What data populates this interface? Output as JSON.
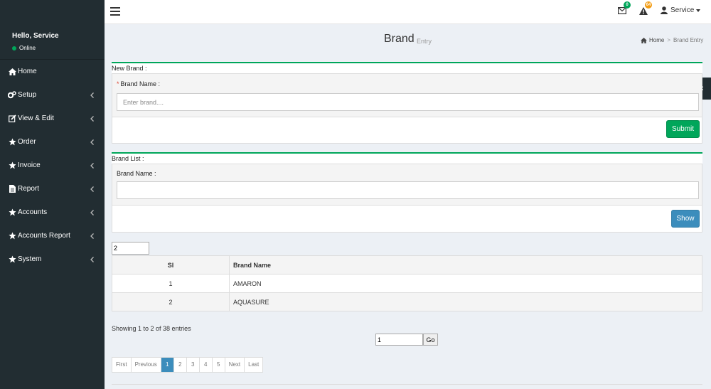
{
  "sidebar": {
    "greeting": "Hello, Service",
    "status": "Online",
    "items": [
      {
        "label": "Home",
        "icon": "home-icon",
        "chevron": false
      },
      {
        "label": "Setup",
        "icon": "cogs-icon",
        "chevron": true
      },
      {
        "label": "View & Edit",
        "icon": "edit-icon",
        "chevron": true
      },
      {
        "label": "Order",
        "icon": "star-icon",
        "chevron": true
      },
      {
        "label": "Invoice",
        "icon": "star-icon",
        "chevron": true
      },
      {
        "label": "Report",
        "icon": "file-icon",
        "chevron": true
      },
      {
        "label": "Accounts",
        "icon": "star-icon",
        "chevron": true
      },
      {
        "label": "Accounts Report",
        "icon": "star-icon",
        "chevron": true
      },
      {
        "label": "System",
        "icon": "star-icon",
        "chevron": true
      }
    ]
  },
  "header": {
    "mail_badge": "0",
    "alert_badge": "64",
    "user_label": "Service",
    "badge_colors": {
      "mail": "#00a65a",
      "alert": "#f39c12"
    }
  },
  "page": {
    "title": "Brand",
    "subtitle": "Entry",
    "breadcrumb": {
      "home": "Home",
      "current": "Brand Entry"
    }
  },
  "new_brand": {
    "title": "New Brand :",
    "label": "Brand Name :",
    "required_mark": "*",
    "placeholder": "Enter brand....",
    "submit_label": "Submit"
  },
  "brand_list": {
    "title": "Brand List :",
    "label": "Brand Name :",
    "value": "",
    "show_label": "Show"
  },
  "table": {
    "page_length": "2",
    "columns": [
      "Sl",
      "Brand Name"
    ],
    "rows": [
      {
        "sl": "1",
        "name": "AMARON"
      },
      {
        "sl": "2",
        "name": "AQUASURE"
      }
    ],
    "info": "Showing 1 to 2 of 38 entries",
    "goto_value": "1",
    "goto_label": "Go"
  },
  "pagination": {
    "first": "First",
    "previous": "Previous",
    "pages": [
      "1",
      "2",
      "3",
      "4",
      "5"
    ],
    "active_page": "1",
    "next": "Next",
    "last": "Last"
  },
  "colors": {
    "sidebar_bg": "#222d32",
    "accent_green": "#00a65a",
    "accent_blue": "#3c8dbc"
  }
}
